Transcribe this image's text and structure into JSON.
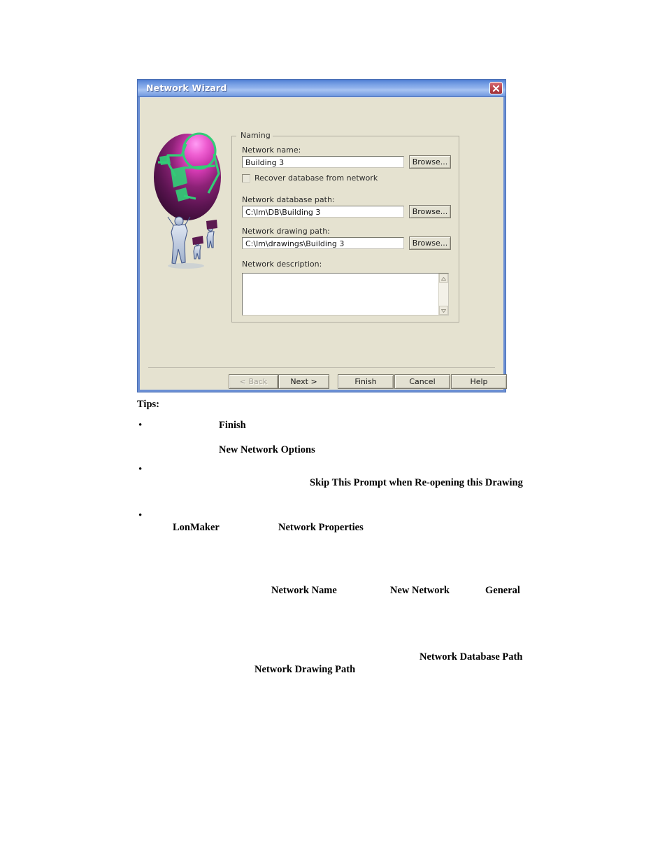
{
  "dialog": {
    "title": "Network Wizard",
    "close_icon": "close-icon",
    "illustration_alt": "network-globe-illustration",
    "group": {
      "legend": "Naming",
      "fields": [
        {
          "label": "Network name:",
          "value": "Building 3",
          "placeholder": "",
          "browse_label": "Browse..."
        },
        {
          "label": "Network database path:",
          "value": "C:\\lm\\DB\\Building 3",
          "placeholder": "",
          "browse_label": "Browse..."
        },
        {
          "label": "Network drawing path:",
          "value": "C:\\lm\\drawings\\Building 3",
          "placeholder": "",
          "browse_label": "Browse..."
        }
      ],
      "checkbox": {
        "label": "Recover database from network",
        "checked": false
      },
      "description": {
        "label": "Network description:",
        "value": "",
        "placeholder": ""
      }
    },
    "buttons": [
      {
        "label": "< Back",
        "disabled": true
      },
      {
        "label": "Next >",
        "disabled": false
      },
      {
        "label": "Finish",
        "disabled": false
      },
      {
        "label": "Cancel",
        "disabled": false
      },
      {
        "label": "Help",
        "disabled": false
      }
    ],
    "colors": {
      "titlebar_blue": "#5d8ada",
      "dialog_face": "#e5e2d0",
      "close_red": "#c14b52",
      "globe_magenta": "#e040c0",
      "globe_purple": "#5c1a50",
      "globe_green": "#33cc77"
    }
  },
  "document": {
    "heading": "Tips:",
    "lines": [
      {
        "text": "Finish"
      },
      {
        "text": "New Network Options"
      },
      {
        "text": "Skip This Prompt when Re-opening this Drawing"
      },
      {
        "text": "LonMaker"
      },
      {
        "text": "Network Properties"
      },
      {
        "text": "Network Name"
      },
      {
        "text": "New Network"
      },
      {
        "text": "General"
      },
      {
        "text": "Network Database Path"
      },
      {
        "text": "Network Drawing Path"
      }
    ]
  }
}
